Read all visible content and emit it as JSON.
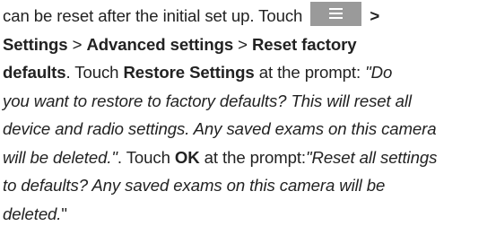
{
  "lines": {
    "l1": {
      "t1": "can be reset after the initial set up. Touch ",
      "icon": "menu-icon",
      "t2": " >"
    },
    "l2": {
      "b1": "Settings",
      "t1": " > ",
      "b2": "Advanced settings",
      "t2": " > ",
      "b3": "Reset factory"
    },
    "l3": {
      "b1": "defaults",
      "t1": ". Touch ",
      "b2": "Restore Settings",
      "t2": " at the prompt: ",
      "i1": "\"Do"
    },
    "l4": {
      "i1": "you want to restore to factory defaults? This will reset all"
    },
    "l5": {
      "i1": "device and radio settings. Any saved exams on this camera"
    },
    "l6": {
      "i1": "will be deleted.\"",
      "t1": ". Touch ",
      "b1": "OK",
      "t2": " at the prompt:",
      "i2": "\"Reset all settings"
    },
    "l7": {
      "i1": "to defaults? Any saved exams on this camera will be"
    },
    "l8": {
      "i1": "deleted.",
      "t1": "\""
    }
  },
  "colors": {
    "text": "#222222",
    "menu_button_bg": "#9a9a9a",
    "menu_button_lines": "#ffffff"
  }
}
